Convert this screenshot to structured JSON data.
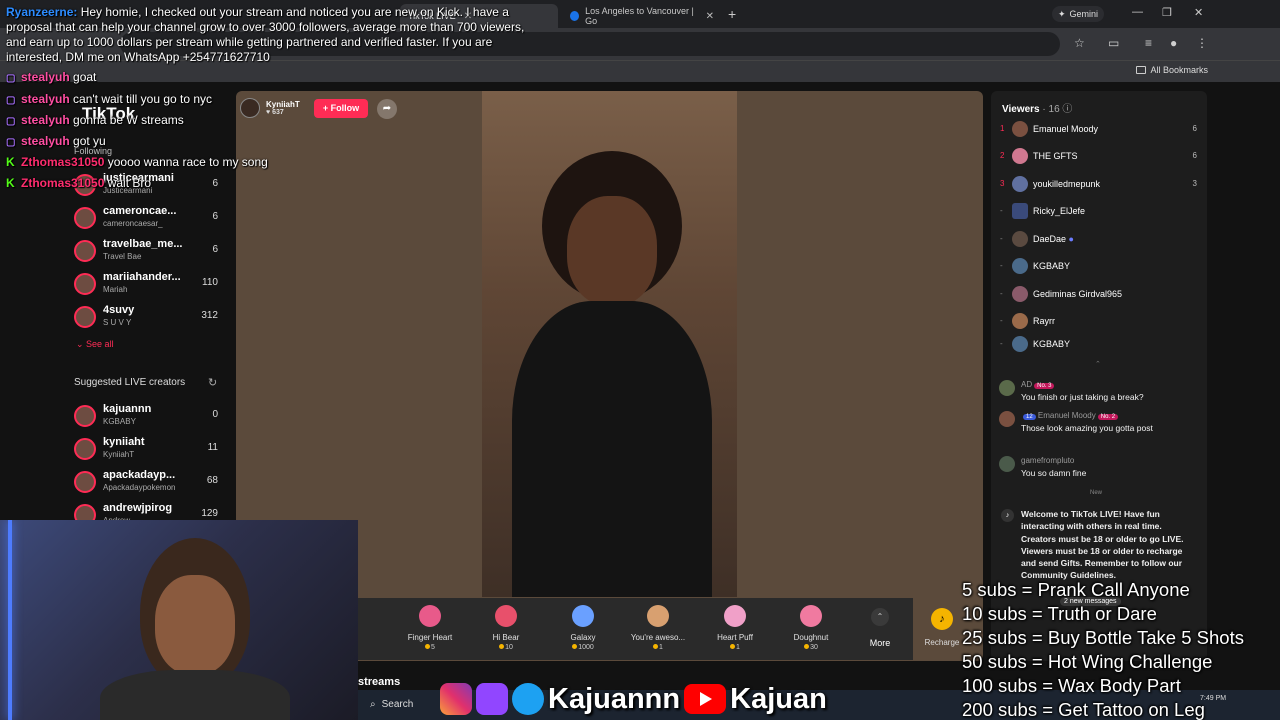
{
  "browser": {
    "tabs": [
      {
        "label": "TikTok LIVE",
        "active": true
      },
      {
        "label": "Los Angeles to Vancouver | Go",
        "active": false
      }
    ],
    "gemini_label": "Gemini",
    "all_bookmarks": "All Bookmarks"
  },
  "sidebar": {
    "logo": "TikTok",
    "following_label": "Following",
    "following": [
      {
        "name": "justicearmani",
        "sub": "Justicearmani",
        "count": "6"
      },
      {
        "name": "cameroncae...",
        "sub": "cameroncaesar_",
        "count": "6"
      },
      {
        "name": "travelbae_me...",
        "sub": "Travel Bae",
        "count": "6"
      },
      {
        "name": "mariiahander...",
        "sub": "Mariah",
        "count": "110"
      },
      {
        "name": "4suvy",
        "sub": "S U V Y",
        "count": "312"
      }
    ],
    "see_all": "See all",
    "suggested_label": "Suggested LIVE creators",
    "suggested": [
      {
        "name": "kajuannn",
        "sub": "KGBABY",
        "count": "0"
      },
      {
        "name": "kyniiaht",
        "sub": "KyniiahT",
        "count": "11"
      },
      {
        "name": "apackadayp...",
        "sub": "Apackadaypokemon",
        "count": "68"
      },
      {
        "name": "andrewjpirog",
        "sub": "Andrew",
        "count": "129"
      }
    ]
  },
  "stream": {
    "host_name": "KyniiahT",
    "host_likes": "637",
    "follow_label": "+ Follow"
  },
  "gifts": [
    {
      "name": "Finger Heart",
      "price": "5",
      "color": "#e85a8a"
    },
    {
      "name": "Hi Bear",
      "price": "10",
      "color": "#e8506b"
    },
    {
      "name": "Galaxy",
      "price": "1000",
      "color": "#6aa0ff"
    },
    {
      "name": "You're aweso...",
      "price": "1",
      "color": "#d8a070"
    },
    {
      "name": "Heart Puff",
      "price": "1",
      "color": "#f0a0c8"
    },
    {
      "name": "Doughnut",
      "price": "30",
      "color": "#f07aa0"
    }
  ],
  "gift_more": "More",
  "recharge": "Recharge",
  "viewers": {
    "title": "Viewers",
    "count": "16",
    "list": [
      {
        "rank": "1",
        "name": "Emanuel Moody",
        "score": "6"
      },
      {
        "rank": "2",
        "name": "THE GFTS",
        "score": "6"
      },
      {
        "rank": "3",
        "name": "youkilledmepunk",
        "score": "3"
      },
      {
        "rank": "-",
        "name": "Ricky_ElJefe",
        "score": ""
      },
      {
        "rank": "-",
        "name": "DaeDae",
        "score": ""
      },
      {
        "rank": "-",
        "name": "KGBABY",
        "score": ""
      },
      {
        "rank": "-",
        "name": "Gediminas Girdval965",
        "score": ""
      },
      {
        "rank": "-",
        "name": "Rayrr",
        "score": ""
      },
      {
        "rank": "-",
        "name": "KGBABY",
        "score": ""
      }
    ]
  },
  "chat": [
    {
      "user": "AD",
      "badge": "No. 3",
      "text": "You finish or just taking a break?"
    },
    {
      "user": "Emanuel Moody",
      "level": "12",
      "badge": "No. 2",
      "text": "Those look amazing you gotta post"
    },
    {
      "user": "gamefrompluto",
      "text": "You so damn fine"
    }
  ],
  "chat_new": "New",
  "welcome_text": "Welcome to TikTok LIVE! Have fun interacting with others in real time. Creators must be 18 or older to go LIVE. Viewers must be 18 or older to recharge and send Gifts. Remember to follow our Community Guidelines.",
  "new_messages": "2 new messages",
  "overlay": {
    "ad_user": "Ryanzeerne:",
    "ad_text": "Hey homie, I checked out your stream and noticed you are new on Kick. I have a proposal that can help your channel grow to over 3000 followers, average more than 700 viewers, and earn up to 1000 dollars per stream while getting partnered and verified faster. If you are interested, DM me on WhatsApp +254771627710",
    "lines": [
      {
        "platform": "twitch",
        "user": "stealyuh",
        "color": "#ff4fa3",
        "text": "goat"
      },
      {
        "platform": "twitch",
        "user": "stealyuh",
        "color": "#ff4fa3",
        "text": "can't wait till you go to nyc"
      },
      {
        "platform": "twitch",
        "user": "stealyuh",
        "color": "#ff4fa3",
        "text": "gonna be W streams"
      },
      {
        "platform": "twitch",
        "user": "stealyuh",
        "color": "#ff4fa3",
        "text": "got yu"
      },
      {
        "platform": "kick",
        "user": "Zthomas31050",
        "color": "#ff2d6f",
        "text": "yoooo wanna race to my song"
      },
      {
        "platform": "kick",
        "user": "Zthomas31050",
        "color": "#ff2d6f",
        "text": "wait Bro"
      }
    ]
  },
  "sub_goals": [
    "5 subs = Prank Call Anyone",
    "10 subs = Truth or Dare",
    "25 subs = Buy Bottle Take 5 Shots",
    "50 subs = Hot Wing Challenge",
    "100 subs = Wax Body Part",
    "200 subs = Get Tattoo on Leg"
  ],
  "socials": {
    "handle1": "Kajuannn",
    "handle2": "Kajuan"
  },
  "taskbar": {
    "search": "Search",
    "streams": "streams",
    "time": "7:49 PM"
  }
}
